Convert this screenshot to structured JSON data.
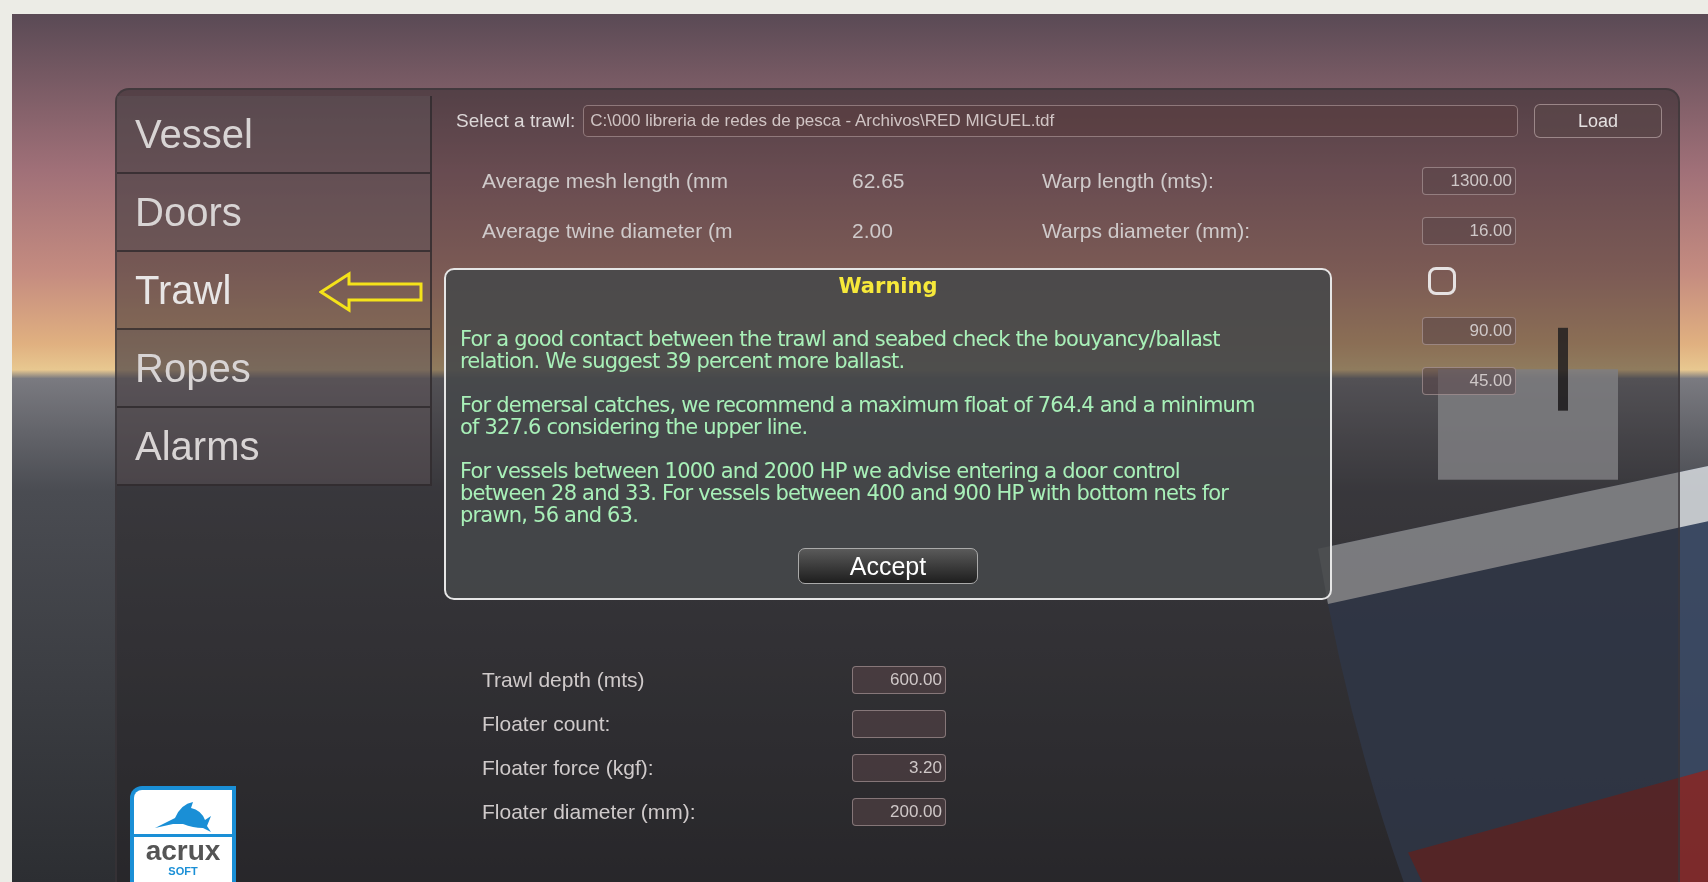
{
  "tabs": [
    {
      "label": "Vessel",
      "selected": false
    },
    {
      "label": "Doors",
      "selected": false
    },
    {
      "label": "Trawl",
      "selected": true
    },
    {
      "label": "Ropes",
      "selected": false
    },
    {
      "label": "Alarms",
      "selected": false
    }
  ],
  "trawl_select": {
    "label": "Select a trawl:",
    "value": "C:\\000 libreria de redes de pesca - Archivos\\RED MIGUEL.tdf",
    "button": "Load"
  },
  "left_fields_top": [
    {
      "kind": "text",
      "label": "Average mesh length (mm",
      "value": "62.65"
    },
    {
      "kind": "text",
      "label": "Average twine diameter (m",
      "value": "2.00"
    }
  ],
  "left_fields_bottom": [
    {
      "kind": "box",
      "label": "Trawl depth (mts)",
      "value": "600.00"
    },
    {
      "kind": "box",
      "label": "Floater count:"
    },
    {
      "kind": "box",
      "label": "Floater force (kgf):",
      "value": "3.20"
    },
    {
      "kind": "box",
      "label": "Floater diameter (mm):",
      "value": "200.00"
    }
  ],
  "right_fields": [
    {
      "kind": "box",
      "label": "Warp length (mts):",
      "value": "1300.00"
    },
    {
      "kind": "box",
      "label": "Warps diameter (mm):",
      "value": "16.00"
    },
    {
      "kind": "toggle",
      "on": false
    },
    {
      "kind": "box",
      "value": "90.00"
    },
    {
      "kind": "box",
      "value": "45.00"
    }
  ],
  "dialog": {
    "title": "Warning",
    "paragraphs": [
      "For a good contact between the trawl and seabed check the bouyancy/ballast relation. We suggest 39 percent more ballast.",
      "For demersal catches, we recommend a maximum float of 764.4 and a minimum of 327.6 considering the upper line.",
      "For vessels between 1000 and 2000 HP we advise entering a door control between 28 and 33. For vessels between 400 and 900 HP with bottom nets for prawn, 56 and 63."
    ],
    "button": "Accept"
  },
  "logo": {
    "name": "acrux",
    "sub": "SOFT"
  }
}
